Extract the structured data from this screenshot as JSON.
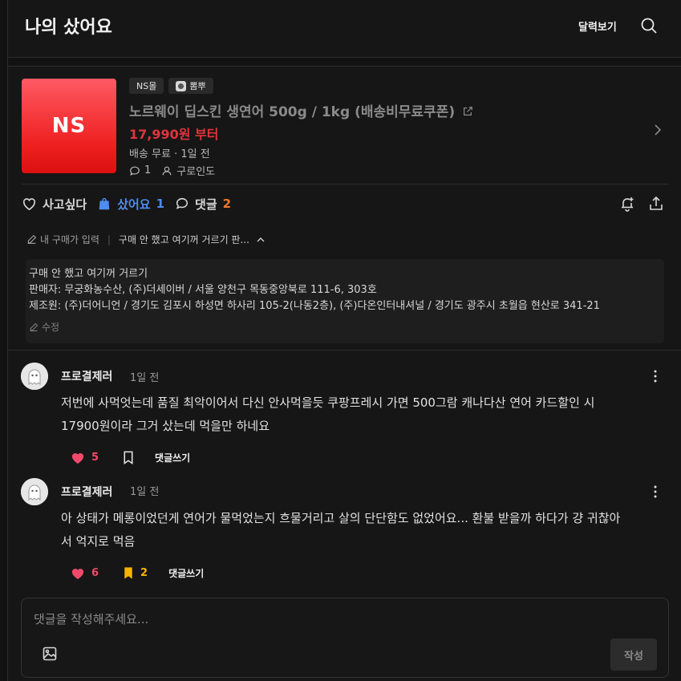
{
  "header": {
    "title": "나의 샀어요",
    "calendar_label": "달력보기"
  },
  "product": {
    "thumb_text": "NS",
    "tags": [
      "NS몰",
      "뽐뿌"
    ],
    "title": "노르웨이 딥스킨 생연어 500g / 1kg (배송비무료쿠폰)",
    "price": "17,990원 부터",
    "shipping_time": "배송 무료 · 1일 전",
    "comment_count": "1",
    "author": "구로인도"
  },
  "actions": {
    "want_label": "사고싶다",
    "bought_label": "샀어요",
    "bought_count": "1",
    "comments_label": "댓글",
    "comments_count": "2"
  },
  "purchase": {
    "price_input_label": "내 구매가 입력",
    "reason_short": "구매 안 했고 여기꺼 거르기 판...",
    "info_line1": "구매 안 했고 여기꺼 거르기",
    "info_line2": "판매자: 무궁화농수산, (주)더세이버 / 서울 양천구 목동중앙북로 111-6, 303호",
    "info_line3": "제조원: (주)더어니언 / 경기도 김포시 하성면 하사리 105-2(나동2층), (주)다온인터내셔널 / 경기도 광주시 초월읍 현산로 341-21",
    "edit_label": "수정"
  },
  "comments": [
    {
      "name": "프로결제러",
      "time": "1일 전",
      "body_line1": "저번에 사먹엇는데 품질 최악이어서 다신 안사먹을듯 쿠팡프레시 가면 500그람 캐나다산 연어 카드할인 시",
      "body_line2": "17900원이라 그거 샀는데 먹을만 하네요",
      "likes": "5",
      "bookmarks": "",
      "reply_label": "댓글쓰기"
    },
    {
      "name": "프로결제러",
      "time": "1일 전",
      "body_line1": "아 상태가 메롱이었던게 연어가 물먹었는지 흐물거리고 살의 단단함도 없었어요... 환불 받을까 하다가 걍 귀찮아",
      "body_line2": "서 억지로 먹음",
      "likes": "6",
      "bookmarks": "2",
      "reply_label": "댓글쓰기"
    }
  ],
  "composer": {
    "placeholder": "댓글을 작성해주세요...",
    "submit_label": "작성"
  },
  "colors": {
    "price_red": "#e0343c",
    "bought_blue": "#4f8cf0",
    "comments_orange": "#f07a2a",
    "heart_pink": "#f04a6a",
    "bookmark_yellow": "#f6b400"
  }
}
